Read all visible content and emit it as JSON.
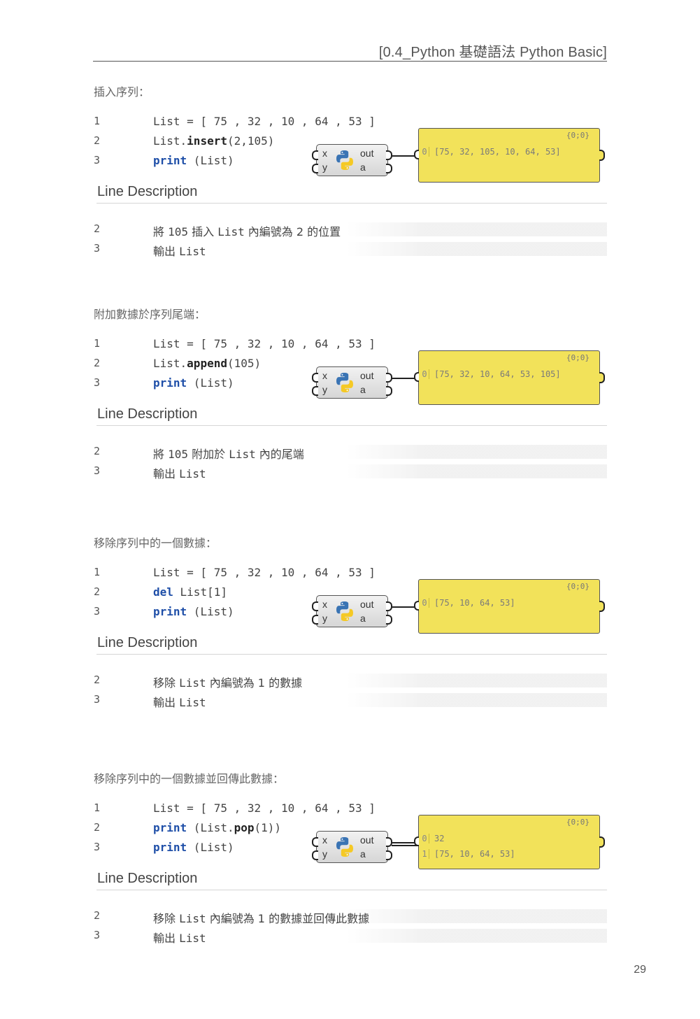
{
  "header": {
    "title": "[0.4_Python 基礎語法 Python Basic]"
  },
  "desc_heading": "Line Description",
  "page_number": "29",
  "component": {
    "input_x": "x",
    "input_y": "y",
    "output_out": "out",
    "output_a": "a",
    "icon": "python-logo-icon"
  },
  "colors": {
    "panel": "#f2e25a",
    "keyword": "#1f4fa8"
  },
  "sections": [
    {
      "title": "插入序列：",
      "code": [
        {
          "n": "1",
          "parts": [
            [
              "",
              "List = [ 75 , 32 , 10 , 64 , 53 ]"
            ]
          ]
        },
        {
          "n": "2",
          "parts": [
            [
              "",
              "List."
            ],
            [
              "fn",
              "insert"
            ],
            [
              "",
              "(2,105)"
            ]
          ]
        },
        {
          "n": "3",
          "parts": [
            [
              "kw",
              "print"
            ],
            [
              "",
              " (List)"
            ]
          ]
        }
      ],
      "panel": {
        "tag": "{0;0}",
        "rows": [
          {
            "i": "0",
            "v": "[75, 32, 105, 10, 64, 53]"
          }
        ]
      },
      "desc": [
        {
          "n": "2",
          "parts": [
            [
              "",
              "將 "
            ],
            [
              "mono",
              "105"
            ],
            [
              "",
              " 插入 "
            ],
            [
              "mono",
              "List"
            ],
            [
              "",
              " 內編號為 2 的位置"
            ]
          ]
        },
        {
          "n": "3",
          "parts": [
            [
              "",
              "輸出 "
            ],
            [
              "mono",
              "List"
            ]
          ]
        }
      ]
    },
    {
      "title": "附加數據於序列尾端：",
      "code": [
        {
          "n": "1",
          "parts": [
            [
              "",
              "List = [ 75 , 32 , 10 , 64 , 53 ]"
            ]
          ]
        },
        {
          "n": "2",
          "parts": [
            [
              "",
              "List."
            ],
            [
              "fn",
              "append"
            ],
            [
              "",
              "(105)"
            ]
          ]
        },
        {
          "n": "3",
          "parts": [
            [
              "kw",
              "print"
            ],
            [
              "",
              " (List)"
            ]
          ]
        }
      ],
      "panel": {
        "tag": "{0;0}",
        "rows": [
          {
            "i": "0",
            "v": "[75, 32, 10, 64, 53, 105]"
          }
        ]
      },
      "desc": [
        {
          "n": "2",
          "parts": [
            [
              "",
              "將 "
            ],
            [
              "mono",
              "105"
            ],
            [
              "",
              " 附加於 "
            ],
            [
              "mono",
              "List"
            ],
            [
              "",
              " 內的尾端"
            ]
          ]
        },
        {
          "n": "3",
          "parts": [
            [
              "",
              "輸出 "
            ],
            [
              "mono",
              "List"
            ]
          ]
        }
      ]
    },
    {
      "title": "移除序列中的一個數據：",
      "code": [
        {
          "n": "1",
          "parts": [
            [
              "",
              "List = [ 75 , 32 , 10 , 64 , 53 ]"
            ]
          ]
        },
        {
          "n": "2",
          "parts": [
            [
              "kw",
              "del"
            ],
            [
              "",
              " List[1]"
            ]
          ]
        },
        {
          "n": "3",
          "parts": [
            [
              "kw",
              "print"
            ],
            [
              "",
              " (List)"
            ]
          ]
        }
      ],
      "panel": {
        "tag": "{0;0}",
        "rows": [
          {
            "i": "0",
            "v": "[75, 10, 64, 53]"
          }
        ]
      },
      "desc": [
        {
          "n": "2",
          "parts": [
            [
              "",
              "移除 "
            ],
            [
              "mono",
              "List"
            ],
            [
              "",
              " 內編號為 1 的數據"
            ]
          ]
        },
        {
          "n": "3",
          "parts": [
            [
              "",
              "輸出 "
            ],
            [
              "mono",
              "List"
            ]
          ]
        }
      ]
    },
    {
      "title": "移除序列中的一個數據並回傳此數據：",
      "code": [
        {
          "n": "1",
          "parts": [
            [
              "",
              "List = [ 75 , 32 , 10 , 64 , 53 ]"
            ]
          ]
        },
        {
          "n": "2",
          "parts": [
            [
              "kw",
              "print"
            ],
            [
              "",
              " (List."
            ],
            [
              "fn",
              "pop"
            ],
            [
              "",
              "(1))"
            ]
          ]
        },
        {
          "n": "3",
          "parts": [
            [
              "kw",
              "print"
            ],
            [
              "",
              " (List)"
            ]
          ]
        }
      ],
      "panel": {
        "tag": "{0;0}",
        "rows": [
          {
            "i": "0",
            "v": "32"
          },
          {
            "i": "1",
            "v": "[75, 10, 64, 53]"
          }
        ]
      },
      "desc": [
        {
          "n": "2",
          "parts": [
            [
              "",
              "移除 "
            ],
            [
              "mono",
              "List"
            ],
            [
              "",
              " 內編號為 1 的數據並回傳此數據"
            ]
          ]
        },
        {
          "n": "3",
          "parts": [
            [
              "",
              "輸出 "
            ],
            [
              "mono",
              "List"
            ]
          ]
        }
      ]
    }
  ]
}
